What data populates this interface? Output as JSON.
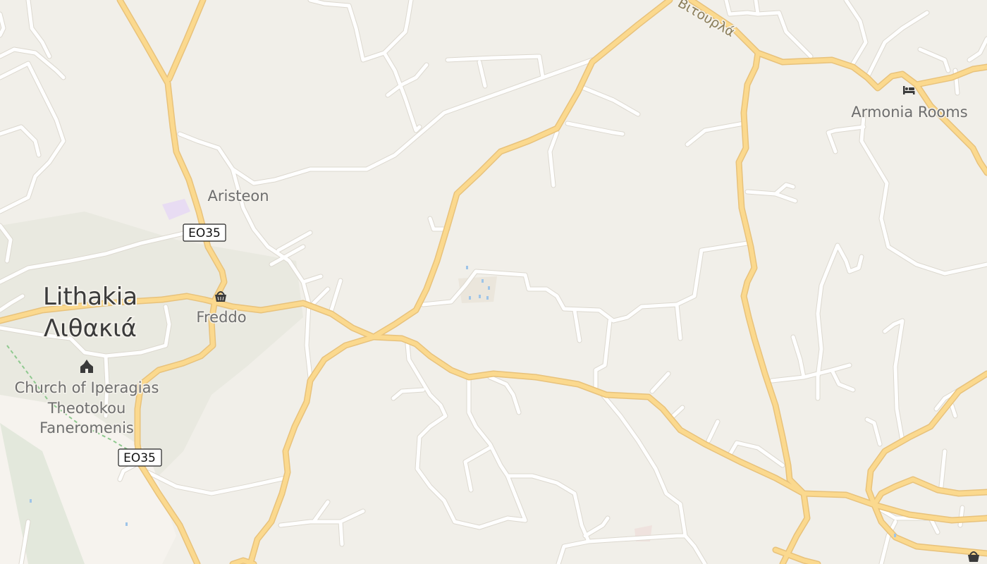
{
  "map": {
    "colors": {
      "land": "#f1efe9",
      "urban": "#e9e8df",
      "major_road": "#fbd98e",
      "major_road_casing": "#e8c27b",
      "minor_road": "#ffffff",
      "path": "#8fc98f"
    },
    "places": [
      {
        "id": "lithakia-latin",
        "label": "Lithakia",
        "kind": "town"
      },
      {
        "id": "lithakia-greek",
        "label": "Λιθακιά",
        "kind": "town"
      }
    ],
    "pois": [
      {
        "id": "aristeon",
        "label": "Aristeon",
        "icon": "none"
      },
      {
        "id": "freddo",
        "label": "Freddo",
        "icon": "shopping-basket-icon"
      },
      {
        "id": "church",
        "label_lines": [
          "Church of Iperagias",
          "Theotokou",
          "Faneromenis"
        ],
        "icon": "church-icon"
      },
      {
        "id": "armonia",
        "label": "Armonia Rooms",
        "icon": "bed-icon"
      }
    ],
    "road_shields": [
      "EO35",
      "EO35"
    ],
    "street_labels": [
      "Βιτουρλά"
    ]
  }
}
